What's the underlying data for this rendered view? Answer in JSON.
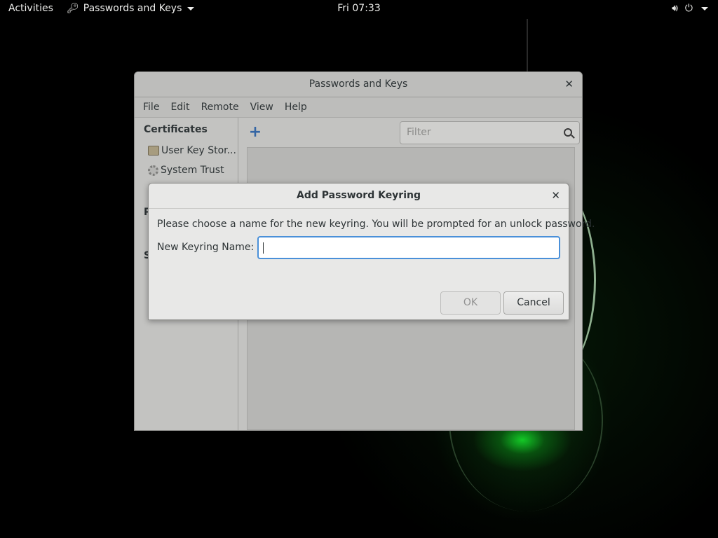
{
  "topbar": {
    "activities": "Activities",
    "app_menu": "Passwords and Keys",
    "clock": "Fri 07:33"
  },
  "window": {
    "title": "Passwords and Keys",
    "menu": [
      "File",
      "Edit",
      "Remote",
      "View",
      "Help"
    ],
    "sidebar": {
      "certificates_heading": "Certificates",
      "items": [
        "User Key Stor...",
        "System Trust"
      ],
      "partial_heading_1": "P",
      "partial_heading_2": "S"
    },
    "filter_placeholder": "Filter"
  },
  "dialog": {
    "title": "Add Password Keyring",
    "message": "Please choose a name for the new keyring. You will be prompted for an unlock password.",
    "field_label": "New Keyring Name:",
    "field_value": "",
    "ok": "OK",
    "cancel": "Cancel"
  },
  "colors": {
    "accent": "#4a90d9",
    "add_icon": "#3465a4"
  }
}
